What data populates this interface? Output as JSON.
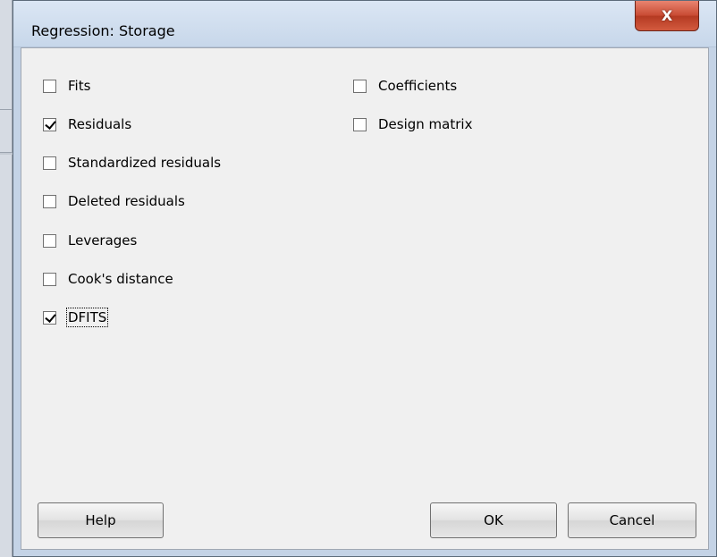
{
  "dialog": {
    "title": "Regression: Storage",
    "close_label": "X"
  },
  "options_left": [
    {
      "label": "Fits",
      "checked": false
    },
    {
      "label": "Residuals",
      "checked": true
    },
    {
      "label": "Standardized residuals",
      "checked": false
    },
    {
      "label": "Deleted residuals",
      "checked": false
    },
    {
      "label": "Leverages",
      "checked": false
    },
    {
      "label": "Cook's distance",
      "checked": false
    },
    {
      "label": "DFITS",
      "checked": true
    }
  ],
  "options_right": [
    {
      "label": "Coefficients",
      "checked": false
    },
    {
      "label": "Design matrix",
      "checked": false
    }
  ],
  "buttons": {
    "help": "Help",
    "ok": "OK",
    "cancel": "Cancel"
  },
  "colors": {
    "close_button": "#c84a32",
    "title_bar": "#c4d3e6",
    "client_bg": "#f0f0f0"
  }
}
